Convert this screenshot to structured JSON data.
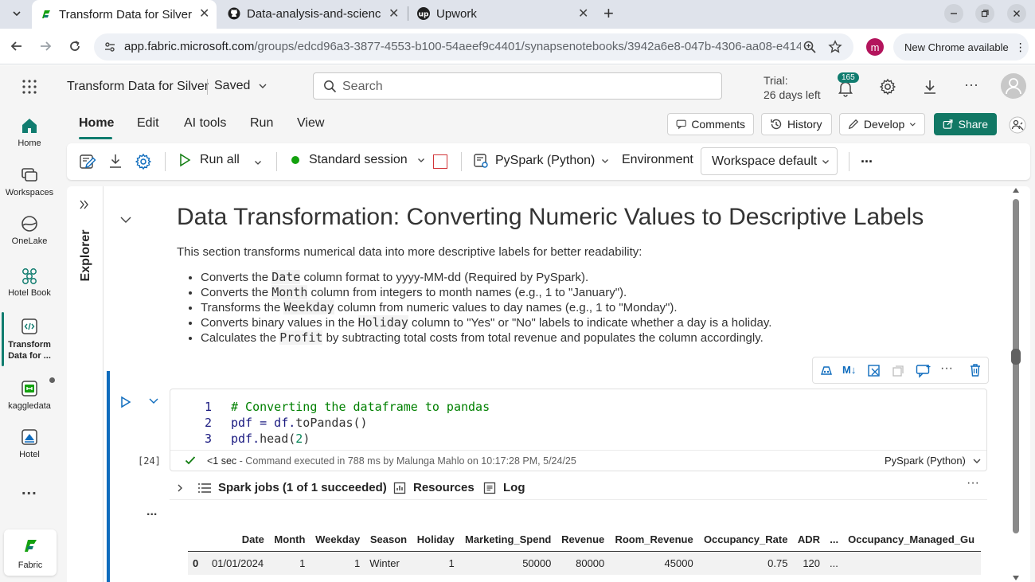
{
  "browser": {
    "tabs": [
      {
        "title": "Transform Data for Silver",
        "icon": "fabric-icon"
      },
      {
        "title": "Data-analysis-and-scienc",
        "icon": "github-icon"
      },
      {
        "title": "Upwork",
        "icon": "upwork-icon"
      }
    ],
    "url_host": "app.fabric.microsoft.com",
    "url_path": "/groups/edcd96a3-3877-4553-b100-54aeef9c4401/synapsenotebooks/3942a6e8-047b-4306-aa08-e414039...",
    "profile_initial": "m",
    "new_chrome": "New Chrome available"
  },
  "topbar": {
    "title": "Transform Data for Silver",
    "saved": "Saved",
    "search_placeholder": "Search",
    "trial_line1": "Trial:",
    "trial_line2": "26 days left",
    "notifications": "165"
  },
  "rail": [
    {
      "label": "Home",
      "icon": "home-icon"
    },
    {
      "label": "Workspaces",
      "icon": "workspaces-icon"
    },
    {
      "label": "OneLake",
      "icon": "onelake-icon"
    },
    {
      "label": "Hotel Book",
      "icon": "hotel-book-icon"
    },
    {
      "label": "Transform Data for ...",
      "icon": "notebook-icon"
    },
    {
      "label": "kaggledata",
      "icon": "pipeline-icon"
    },
    {
      "label": "Hotel",
      "icon": "lakehouse-icon"
    }
  ],
  "rail_more": "...",
  "rail_fabric": "Fabric",
  "ribbon": {
    "tabs": [
      "Home",
      "Edit",
      "AI tools",
      "Run",
      "View"
    ],
    "comments": "Comments",
    "history": "History",
    "develop": "Develop",
    "share": "Share"
  },
  "toolbar": {
    "run_all": "Run all",
    "session": "Standard session",
    "language": "PySpark (Python)",
    "environment": "Environment",
    "workspace": "Workspace default",
    "more": "..."
  },
  "explorer_label": "Explorer",
  "markdown": {
    "heading": "Data Transformation: Converting Numeric Values to Descriptive Labels",
    "intro": "This section transforms numerical data into more descriptive labels for better readability:",
    "bullets": [
      {
        "pre": "Converts the ",
        "code": "Date",
        "post": " column format to yyyy-MM-dd (Required by PySpark)."
      },
      {
        "pre": "Converts the ",
        "code": "Month",
        "post": " column from integers to month names (e.g., 1 to \"January\")."
      },
      {
        "pre": "Transforms the ",
        "code": "Weekday",
        "post": " column from numeric values to day names (e.g., 1 to \"Monday\")."
      },
      {
        "pre": "Converts binary values in the ",
        "code": "Holiday",
        "post": " column to \"Yes\" or \"No\" labels to indicate whether a day is a holiday."
      },
      {
        "pre": "Calculates the ",
        "code": "Profit",
        "post": " by subtracting total costs from total revenue and populates the column accordingly."
      }
    ]
  },
  "cell": {
    "lines": [
      "1",
      "2",
      "3"
    ],
    "code": {
      "comment": "# Converting the dataframe to pandas",
      "l2a": "pdf = df.",
      "l2b": "toPandas",
      "l2c": "()",
      "l3a": "pdf.",
      "l3b": "head",
      "l3c": "(",
      "l3d": "2",
      "l3e": ")"
    },
    "exec_count": "[24]",
    "status_time": "<1 sec",
    "status_detail": " - Command executed in 788 ms by Malunga Mahlo on 10:17:28 PM, 5/24/25",
    "language": "PySpark (Python)",
    "spark_jobs": "Spark jobs (1 of 1 succeeded)",
    "resources": "Resources",
    "log": "Log",
    "more": "..."
  },
  "table": {
    "headers": [
      "",
      "Date",
      "Month",
      "Weekday",
      "Season",
      "Holiday",
      "Marketing_Spend",
      "Revenue",
      "Room_Revenue",
      "Occupancy_Rate",
      "ADR",
      "...",
      "Occupancy_Managed_Gu"
    ],
    "rows": [
      [
        "0",
        "01/01/2024",
        "1",
        "1",
        "Winter",
        "1",
        "50000",
        "80000",
        "45000",
        "0.75",
        "120",
        "...",
        ""
      ]
    ]
  }
}
